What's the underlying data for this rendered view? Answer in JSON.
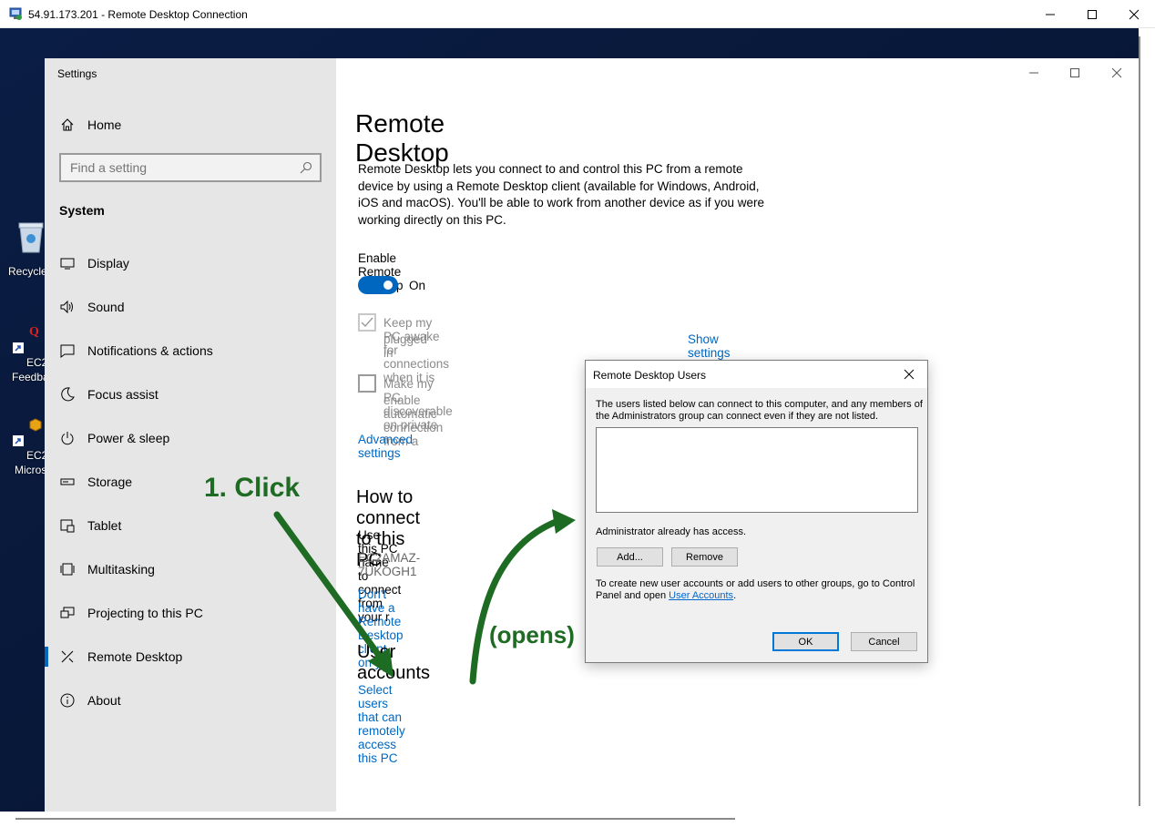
{
  "rdp": {
    "title": "54.91.173.201 - Remote Desktop Connection"
  },
  "desktop": {
    "icons": [
      {
        "label": "Recycle",
        "icon": "recycle-bin-icon"
      },
      {
        "label": "EC2",
        "label2": "Feedba",
        "icon": "ec2-feedback-icon"
      },
      {
        "label": "EC2",
        "label2": "Micros",
        "icon": "ec2-microsoft-icon"
      }
    ]
  },
  "settings": {
    "app_title": "Settings",
    "home": "Home",
    "search_placeholder": "Find a setting",
    "system_heading": "System",
    "sidebar": [
      {
        "label": "Display",
        "icon": "display-icon"
      },
      {
        "label": "Sound",
        "icon": "sound-icon"
      },
      {
        "label": "Notifications & actions",
        "icon": "notifications-icon"
      },
      {
        "label": "Focus assist",
        "icon": "focus-assist-icon"
      },
      {
        "label": "Power & sleep",
        "icon": "power-icon"
      },
      {
        "label": "Storage",
        "icon": "storage-icon"
      },
      {
        "label": "Tablet",
        "icon": "tablet-icon"
      },
      {
        "label": "Multitasking",
        "icon": "multitasking-icon"
      },
      {
        "label": "Projecting to this PC",
        "icon": "projecting-icon"
      },
      {
        "label": "Remote Desktop",
        "icon": "remote-desktop-icon",
        "active": true
      },
      {
        "label": "About",
        "icon": "about-icon"
      }
    ],
    "accent": "#0067c0"
  },
  "main": {
    "title": "Remote Desktop",
    "description": "Remote Desktop lets you connect to and control this PC from a remote device by using a Remote Desktop client (available for Windows, Android, iOS and macOS). You'll be able to work from another device as if you were working directly on this PC.",
    "enable_label": "Enable Remote Desktop",
    "toggle_state": "On",
    "keep_awake_line1": "Keep my PC awake for connections when it is",
    "keep_awake_line2": "plugged in",
    "show_settings": "Show settings",
    "discoverable_line1": "Make my PC discoverable on private",
    "discoverable_line2": "enable automatic connection from a",
    "advanced_settings": "Advanced settings",
    "how_to_heading": "How to connect to this PC",
    "use_pc_name": "Use this PC name to connect from your r",
    "pc_name": "EC2AMAZ-7UKOGH1",
    "no_client_link": "Don't have a Remote Desktop client on y",
    "user_accounts_heading": "User accounts",
    "select_users_link": "Select users that can remotely access this PC"
  },
  "dialog": {
    "title": "Remote Desktop Users",
    "desc_line1": "The users listed below can connect to this computer, and any members of",
    "desc_line2": "the Administrators group can connect even if they are not listed.",
    "admin_access": "Administrator already has access.",
    "add_button": "Add...",
    "remove_button": "Remove",
    "create_line1": "To create new user accounts or add users to other groups, go to Control",
    "create_line2_prefix": "Panel and open ",
    "user_accounts_link": "User Accounts",
    "create_line2_suffix": ".",
    "ok_button": "OK",
    "cancel_button": "Cancel"
  },
  "annotations": {
    "step1": "1. Click",
    "opens": "(opens)",
    "color": "#1e6b23"
  }
}
